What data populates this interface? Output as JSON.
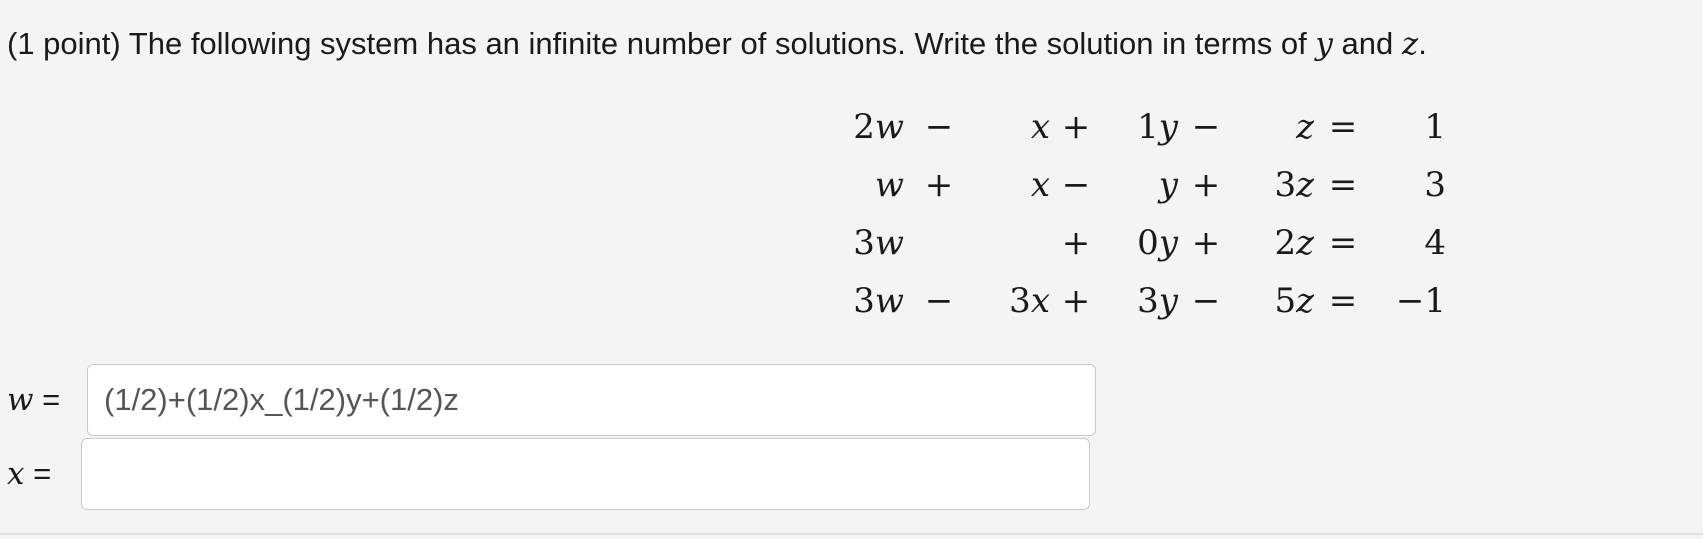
{
  "question": {
    "points": "(1 point)",
    "text_before": " The following system has an infinite number of solutions. Write the solution in terms of ",
    "var_y": "y",
    "text_and": " and ",
    "var_z": "z",
    "text_end": "."
  },
  "system": {
    "rows": [
      {
        "w": {
          "coef": "2",
          "var": "w"
        },
        "op1": "−",
        "x": {
          "coef": "",
          "var": "x"
        },
        "op2": "+",
        "y": {
          "coef": "1",
          "var": "y"
        },
        "op3": "−",
        "z": {
          "coef": "",
          "var": "z"
        },
        "eq": "=",
        "rhs": "1"
      },
      {
        "w": {
          "coef": "",
          "var": "w"
        },
        "op1": "+",
        "x": {
          "coef": "",
          "var": "x"
        },
        "op2": "−",
        "y": {
          "coef": "",
          "var": "y"
        },
        "op3": "+",
        "z": {
          "coef": "3",
          "var": "z"
        },
        "eq": "=",
        "rhs": "3"
      },
      {
        "w": {
          "coef": "3",
          "var": "w"
        },
        "op1": "",
        "x": {
          "coef": "",
          "var": ""
        },
        "op2": "+",
        "y": {
          "coef": "0",
          "var": "y"
        },
        "op3": "+",
        "z": {
          "coef": "2",
          "var": "z"
        },
        "eq": "=",
        "rhs": "4"
      },
      {
        "w": {
          "coef": "3",
          "var": "w"
        },
        "op1": "−",
        "x": {
          "coef": "3",
          "var": "x"
        },
        "op2": "+",
        "y": {
          "coef": "3",
          "var": "y"
        },
        "op3": "−",
        "z": {
          "coef": "5",
          "var": "z"
        },
        "eq": "=",
        "rhs": "−1"
      }
    ]
  },
  "answers": {
    "w": {
      "var": "w",
      "equals": " =",
      "value": "(1/2)+(1/2)x_(1/2)y+(1/2)z"
    },
    "x": {
      "var": "x",
      "equals": " =",
      "value": ""
    }
  }
}
